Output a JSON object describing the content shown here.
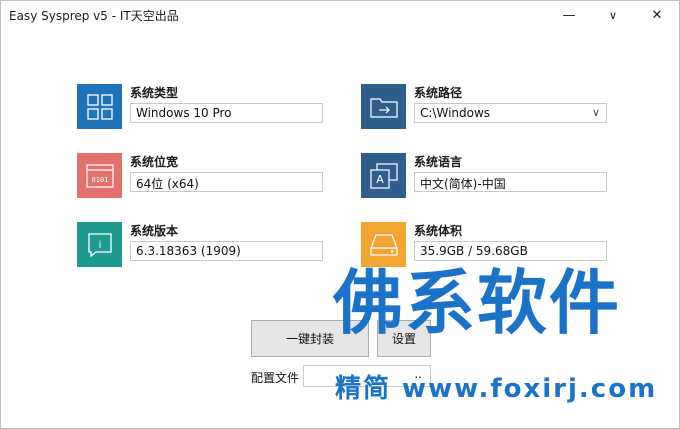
{
  "window": {
    "title": "Easy Sysprep v5 - IT天空出品",
    "minimize_glyph": "—",
    "maximize_glyph": "∨",
    "close_glyph": "✕"
  },
  "colors": {
    "blue_tile": "#1f73b8",
    "red_tile": "#e2716b",
    "teal_tile": "#1e9b8e",
    "navy_tile": "#2f5d8c",
    "orange_tile": "#f2a531",
    "watermark": "#1a73c8"
  },
  "cards": {
    "system_type": {
      "label": "系统类型",
      "value": "Windows 10 Pro",
      "icon": "windows-grid-icon"
    },
    "system_arch": {
      "label": "系统位宽",
      "value": "64位 (x64)",
      "icon": "binary-0101-icon",
      "icon_text": "0101"
    },
    "system_version": {
      "label": "系统版本",
      "value": "6.3.18363 (1909)",
      "icon": "info-icon",
      "icon_text": "i"
    },
    "system_path": {
      "label": "系统路径",
      "value": "C:\\Windows",
      "icon": "folder-arrow-icon",
      "caret": "∨"
    },
    "system_language": {
      "label": "系统语言",
      "value": "中文(简体)-中国",
      "icon": "language-A-icon",
      "icon_text": "A"
    },
    "system_size": {
      "label": "系统体积",
      "value": "35.9GB / 59.68GB",
      "icon": "hard-drive-icon"
    }
  },
  "actions": {
    "seal_label": "一键封装",
    "settings_label": "设置",
    "config_label": "配置文件",
    "config_value": "",
    "browse_label": ".."
  },
  "watermark": {
    "brand": "佛系软件",
    "subtitle": "精简 www.foxirj.com"
  }
}
